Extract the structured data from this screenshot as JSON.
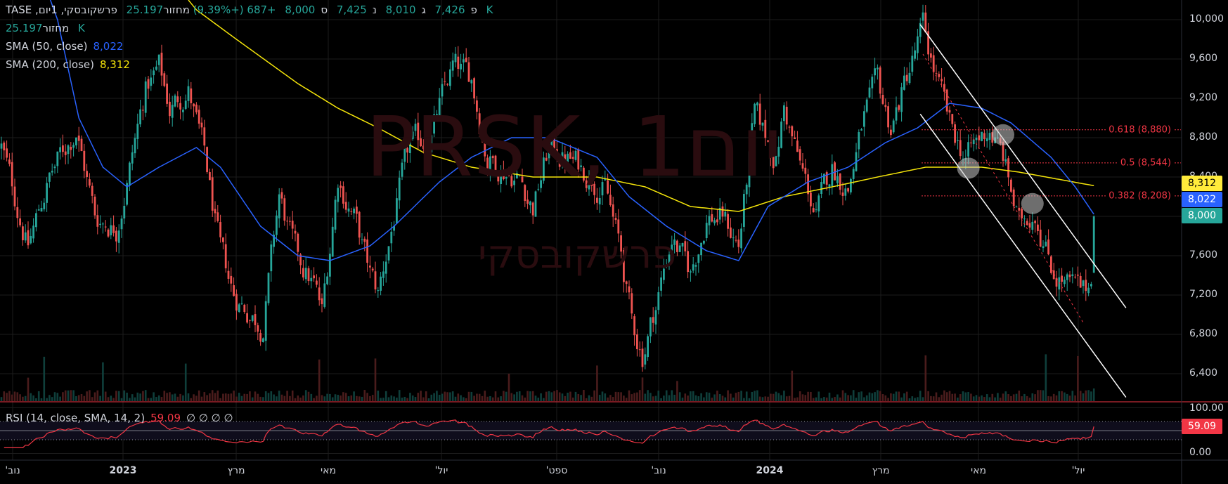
{
  "header": {
    "title": "פרשקובסקי, 1יום, TASE",
    "open_label": "פ",
    "open": "7,426",
    "high_label": "ג",
    "high": "8,010",
    "low_label": "נ",
    "low": "7,425",
    "close_label": "ס",
    "close": "8,000",
    "change": "+687 (+9.39%)",
    "volume_label": "מחזור",
    "volume": "25.197 K"
  },
  "indicators": {
    "volume_label": "מחזור",
    "volume_value": "25.197 K",
    "sma50_label": "SMA (50, close)",
    "sma50_value": "8,022",
    "sma200_label": "SMA (200, close)",
    "sma200_value": "8,312",
    "rsi_label": "RSI (14, close, SMA, 14, 2)",
    "rsi_value": "59.09",
    "rsi_extra": "∅ ∅ ∅ ∅"
  },
  "watermark": {
    "symbol": "PRSK, 1יום",
    "name": "פרשקובסקי"
  },
  "colors": {
    "up": "#26a69a",
    "down": "#ef5350",
    "sma50": "#2962ff",
    "sma200": "#f5e50a",
    "rsi": "#f23645",
    "fib": "#f23645"
  },
  "chart_data": {
    "type": "candlestick",
    "bars": 410,
    "price_axis": {
      "ticks": [
        "10,000",
        "9,600",
        "9,200",
        "8,800",
        "8,400",
        "8,000",
        "7,600",
        "7,200",
        "6,800",
        "6,400"
      ],
      "range": [
        6200,
        10300
      ]
    },
    "time_axis": [
      "נוב'",
      "2023",
      "מרץ",
      "מאי",
      "יול'",
      "ספט'",
      "נוב'",
      "2024",
      "מרץ",
      "מאי",
      "יול'"
    ],
    "close_path": [
      [
        0,
        8700
      ],
      [
        10,
        7700
      ],
      [
        18,
        8400
      ],
      [
        28,
        8900
      ],
      [
        35,
        8000
      ],
      [
        43,
        7900
      ],
      [
        48,
        8500
      ],
      [
        54,
        9300
      ],
      [
        59,
        9500
      ],
      [
        63,
        9100
      ],
      [
        70,
        9300
      ],
      [
        76,
        8600
      ],
      [
        82,
        7600
      ],
      [
        87,
        7200
      ],
      [
        94,
        7000
      ],
      [
        98,
        6900
      ],
      [
        104,
        8200
      ],
      [
        110,
        7600
      ],
      [
        117,
        7300
      ],
      [
        120,
        7000
      ],
      [
        126,
        8400
      ],
      [
        132,
        8000
      ],
      [
        138,
        7400
      ],
      [
        141,
        7200
      ],
      [
        147,
        8000
      ],
      [
        153,
        8700
      ],
      [
        160,
        8800
      ],
      [
        169,
        9500
      ],
      [
        176,
        9400
      ],
      [
        182,
        8600
      ],
      [
        194,
        8400
      ],
      [
        199,
        8100
      ],
      [
        205,
        8700
      ],
      [
        217,
        8500
      ],
      [
        226,
        8300
      ],
      [
        232,
        7600
      ],
      [
        236,
        6900
      ],
      [
        240,
        6600
      ],
      [
        245,
        7100
      ],
      [
        251,
        7800
      ],
      [
        258,
        7400
      ],
      [
        264,
        8000
      ],
      [
        270,
        8000
      ],
      [
        276,
        7700
      ],
      [
        282,
        9000
      ],
      [
        290,
        8600
      ],
      [
        293,
        9100
      ],
      [
        299,
        8500
      ],
      [
        305,
        8000
      ],
      [
        311,
        8500
      ],
      [
        317,
        8300
      ],
      [
        323,
        9000
      ],
      [
        328,
        9300
      ],
      [
        333,
        8900
      ],
      [
        340,
        9500
      ],
      [
        345,
        9900
      ],
      [
        349,
        9500
      ],
      [
        355,
        8900
      ],
      [
        361,
        8600
      ],
      [
        370,
        8900
      ],
      [
        375,
        8600
      ],
      [
        381,
        7900
      ],
      [
        387,
        8100
      ],
      [
        393,
        7500
      ],
      [
        399,
        7300
      ],
      [
        405,
        7200
      ],
      [
        408,
        7313
      ]
    ],
    "last_bar": {
      "open": 7426,
      "high": 8010,
      "low": 7425,
      "close": 8000
    },
    "sma50": [
      [
        17,
        10300
      ],
      [
        21,
        10000
      ],
      [
        29,
        9000
      ],
      [
        38,
        8500
      ],
      [
        47,
        8300
      ],
      [
        59,
        8500
      ],
      [
        73,
        8700
      ],
      [
        82,
        8500
      ],
      [
        97,
        7900
      ],
      [
        111,
        7600
      ],
      [
        123,
        7550
      ],
      [
        138,
        7700
      ],
      [
        147,
        7900
      ],
      [
        164,
        8350
      ],
      [
        176,
        8600
      ],
      [
        191,
        8800
      ],
      [
        205,
        8800
      ],
      [
        223,
        8600
      ],
      [
        235,
        8200
      ],
      [
        249,
        7900
      ],
      [
        264,
        7650
      ],
      [
        276,
        7550
      ],
      [
        287,
        8100
      ],
      [
        302,
        8350
      ],
      [
        317,
        8500
      ],
      [
        331,
        8750
      ],
      [
        343,
        8900
      ],
      [
        355,
        9150
      ],
      [
        367,
        9100
      ],
      [
        378,
        8950
      ],
      [
        393,
        8600
      ],
      [
        402,
        8300
      ],
      [
        409,
        8022
      ]
    ],
    "sma200": [
      [
        70,
        10200
      ],
      [
        73,
        10100
      ],
      [
        88,
        9800
      ],
      [
        111,
        9350
      ],
      [
        126,
        9100
      ],
      [
        141,
        8900
      ],
      [
        158,
        8650
      ],
      [
        176,
        8500
      ],
      [
        199,
        8400
      ],
      [
        223,
        8400
      ],
      [
        241,
        8300
      ],
      [
        258,
        8100
      ],
      [
        276,
        8050
      ],
      [
        293,
        8200
      ],
      [
        311,
        8300
      ],
      [
        328,
        8400
      ],
      [
        346,
        8500
      ],
      [
        367,
        8500
      ],
      [
        381,
        8450
      ],
      [
        409,
        8312
      ]
    ],
    "last_values": {
      "sma200": "8,312",
      "sma50": "8,022",
      "close": "8,000"
    },
    "fib_levels": [
      {
        "label": "0.618 (8,880)",
        "price": 8880
      },
      {
        "label": "0.5 (8,544)",
        "price": 8544
      },
      {
        "label": "0.382 (8,208)",
        "price": 8208
      }
    ],
    "channel": {
      "upper": [
        [
          344,
          9950
        ],
        [
          421,
          7070
        ]
      ],
      "lower": [
        [
          344,
          9040
        ],
        [
          421,
          6160
        ]
      ]
    },
    "trend_dashed": [
      [
        345,
        9650
      ],
      [
        405,
        6920
      ]
    ],
    "circles": [
      [
        375,
        8830
      ],
      [
        362,
        8490
      ],
      [
        386,
        8130
      ]
    ],
    "rsi": {
      "range": [
        0,
        100
      ],
      "ticks": [
        "100.00",
        "0.00"
      ],
      "bands": [
        70,
        30
      ],
      "last": "59.09"
    }
  }
}
